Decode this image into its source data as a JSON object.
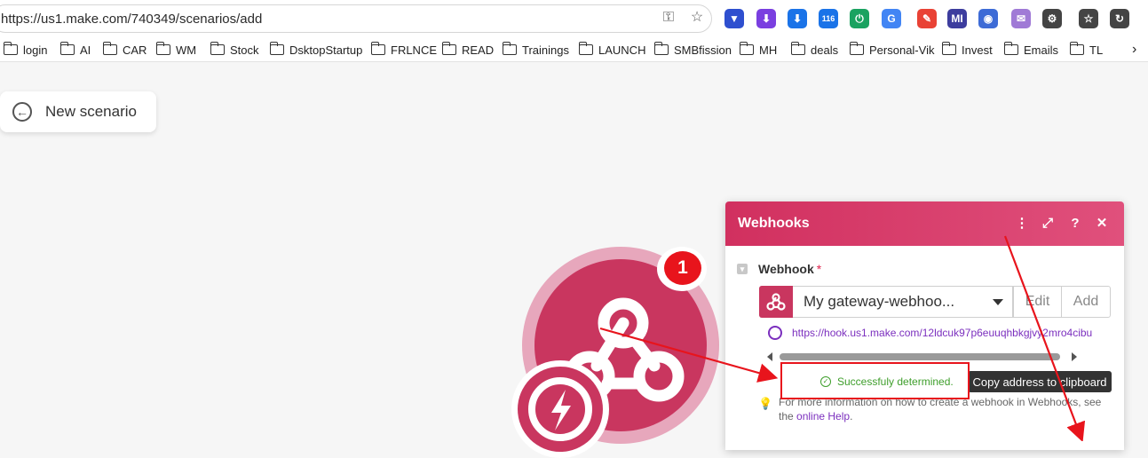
{
  "browser": {
    "url": "https://us1.make.com/740349/scenarios/add",
    "extensions": [
      {
        "name": "vivaldi-icon",
        "color": "#2e4fcf",
        "glyph": "▼"
      },
      {
        "name": "purple-arrow-icon",
        "color": "#7a3fe0",
        "glyph": "⬇"
      },
      {
        "name": "download-icon",
        "color": "#1a73e8",
        "glyph": "⬇"
      },
      {
        "name": "extension-badge-icon",
        "color": "#1a73e8",
        "glyph": "116"
      },
      {
        "name": "power-icon",
        "color": "#1aa260",
        "glyph": "⏻"
      },
      {
        "name": "translate-icon",
        "color": "#4285f4",
        "glyph": "G"
      },
      {
        "name": "pen-extension-icon",
        "color": "#e94235",
        "glyph": "✎"
      },
      {
        "name": "mi-extension-icon",
        "color": "#3d3d9e",
        "glyph": "MI"
      },
      {
        "name": "alien-extension-icon",
        "color": "#3d6bd6",
        "glyph": "◉"
      },
      {
        "name": "mail-extension-icon",
        "color": "#a07ad6",
        "glyph": "✉"
      },
      {
        "name": "puzzle-icon",
        "color": "#444444",
        "glyph": "⚙"
      },
      {
        "name": "favorites-icon",
        "color": "#444444",
        "glyph": "☆"
      },
      {
        "name": "history-icon",
        "color": "#444444",
        "glyph": "↻"
      }
    ]
  },
  "bookmarks": [
    "login",
    "AI",
    "CAR",
    "WM",
    "Stock",
    "DsktopStartup",
    "FRLNCE",
    "READ",
    "Trainings",
    "LAUNCH",
    "SMBfission",
    "MH",
    "deals",
    "Personal-Vik",
    "Invest",
    "Emails",
    "TL"
  ],
  "scenario": {
    "back_label": "New scenario",
    "module_badge": "1"
  },
  "panel": {
    "title": "Webhooks",
    "field_label": "Webhook",
    "required_mark": "*",
    "selected_hook": "My gateway-webhoo...",
    "edit_label": "Edit",
    "add_label": "Add",
    "hook_url": "https://hook.us1.make.com/12ldcuk97p6euuqhbkgjvy2mro4cibu",
    "status_text": "Successfuly determined.",
    "copy_label": "Copy address to clipboard",
    "info_text": "For more information on how to create a webhook in Webhooks, see the",
    "help_link": "online Help",
    "info_end": "."
  },
  "colors": {
    "brand": "#c9365f",
    "panel_header": "#d1305f",
    "success": "#3e9e2b",
    "link": "#7b2fbe",
    "annotation": "#e8141c"
  }
}
